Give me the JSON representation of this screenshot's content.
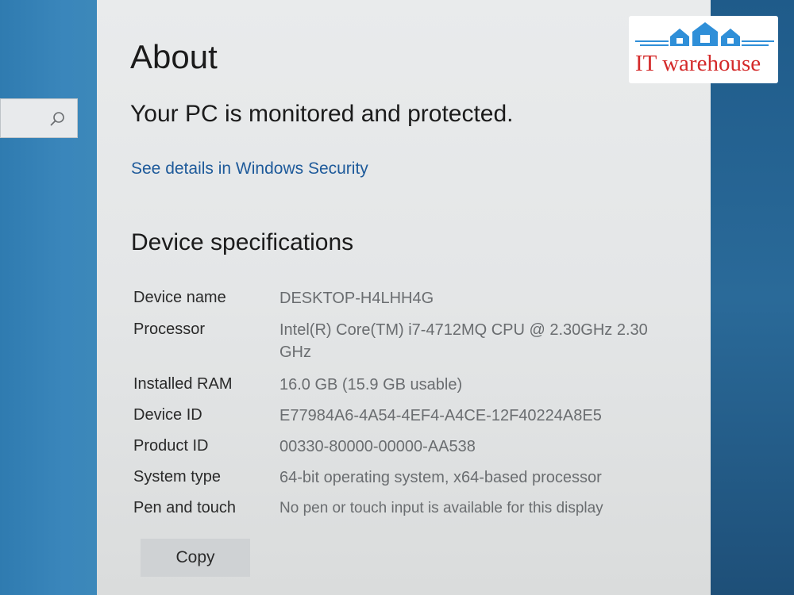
{
  "page": {
    "title": "About",
    "status": "Your PC is monitored and protected.",
    "security_link": "See details in Windows Security"
  },
  "specs": {
    "section_title": "Device specifications",
    "rows": [
      {
        "label": "Device name",
        "value": "DESKTOP-H4LHH4G"
      },
      {
        "label": "Processor",
        "value": "Intel(R) Core(TM) i7-4712MQ CPU @ 2.30GHz   2.30 GHz"
      },
      {
        "label": "Installed RAM",
        "value": "16.0 GB (15.9 GB usable)"
      },
      {
        "label": "Device ID",
        "value": "E77984A6-4A54-4EF4-A4CE-12F40224A8E5"
      },
      {
        "label": "Product ID",
        "value": "00330-80000-00000-AA538"
      },
      {
        "label": "System type",
        "value": "64-bit operating system, x64-based processor"
      },
      {
        "label": "Pen and touch",
        "value": "No pen or touch input is available for this display"
      }
    ],
    "copy_label": "Copy"
  },
  "watermark": {
    "text": "IT warehouse",
    "text_color": "#d42a2a",
    "icon_color": "#2f8fd8"
  },
  "colors": {
    "link": "#1e5a9a",
    "window_bg": "#e6e8e9",
    "desktop_bg": "#3a86bb"
  },
  "icons": {
    "search": "search-icon"
  }
}
